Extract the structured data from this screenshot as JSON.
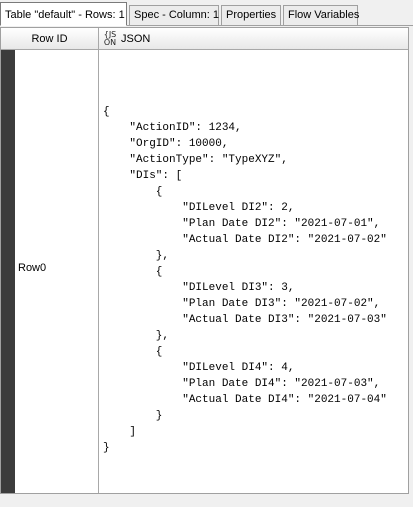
{
  "tabs": [
    {
      "label": "Table \"default\" - Rows: 1"
    },
    {
      "label": "Spec - Column: 1"
    },
    {
      "label": "Properties"
    },
    {
      "label": "Flow Variables"
    }
  ],
  "table": {
    "headers": {
      "row_id": "Row ID",
      "json_type_icon_top": "{JS",
      "json_type_icon_bottom": "ON",
      "json": "JSON"
    },
    "rows": [
      {
        "row_id": "Row0",
        "json": "{\n    \"ActionID\": 1234,\n    \"OrgID\": 10000,\n    \"ActionType\": \"TypeXYZ\",\n    \"DIs\": [\n        {\n            \"DILevel DI2\": 2,\n            \"Plan Date DI2\": \"2021-07-01\",\n            \"Actual Date DI2\": \"2021-07-02\"\n        },\n        {\n            \"DILevel DI3\": 3,\n            \"Plan Date DI3\": \"2021-07-02\",\n            \"Actual Date DI3\": \"2021-07-03\"\n        },\n        {\n            \"DILevel DI4\": 4,\n            \"Plan Date DI4\": \"2021-07-03\",\n            \"Actual Date DI4\": \"2021-07-04\"\n        }\n    ]\n}"
      }
    ]
  },
  "colors": {
    "row_stripe": "#3c3c3c",
    "background": "#f0f0f0"
  }
}
